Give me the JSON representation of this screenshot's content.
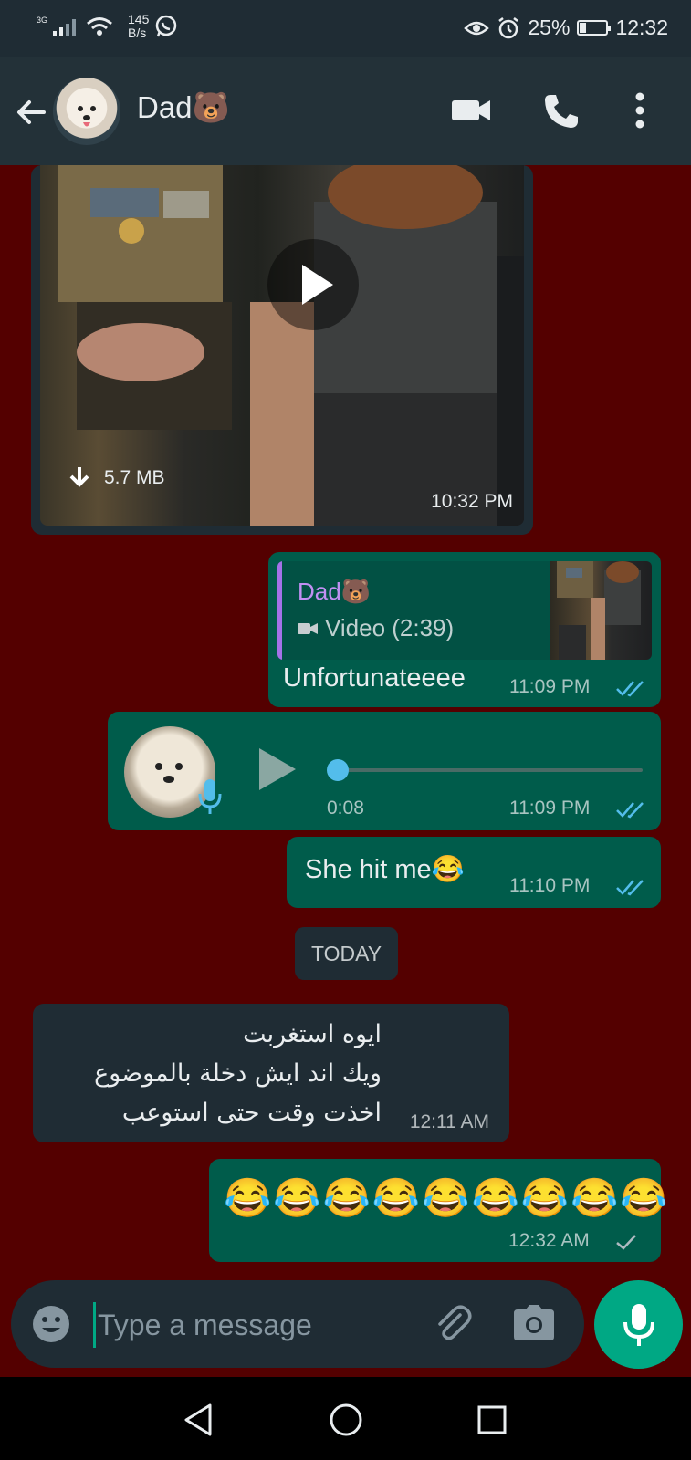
{
  "status_bar": {
    "network": "3G",
    "speed_value": "145",
    "speed_unit": "B/s",
    "battery": "25%",
    "battery_level": 0.25,
    "time": "12:32"
  },
  "header": {
    "contact_name": "Dad🐻",
    "icons": [
      "back-arrow-icon",
      "avatar",
      "video-call-icon",
      "phone-icon",
      "more-vert-icon"
    ]
  },
  "messages": {
    "video": {
      "size": "5.7 MB",
      "time": "10:32 PM"
    },
    "reply": {
      "quoted_name": "Dad🐻",
      "quoted_text": "Video (2:39)",
      "text": "Unfortunateeee",
      "time": "11:09 PM"
    },
    "voice": {
      "duration": "0:08",
      "time": "11:09 PM",
      "progress": 0
    },
    "she_hit": {
      "text": "She hit me😂",
      "time": "11:10 PM"
    },
    "day_separator": "TODAY",
    "arabic": {
      "line1": "ايوه استغربت",
      "line2": "ويك اند ايش دخلة بالموضوع",
      "line3": "اخذت وقت حتى استوعب",
      "time": "12:11 AM"
    },
    "laughs": {
      "emojis": [
        "😂",
        "😂",
        "😂",
        "😂",
        "😂",
        "😂",
        "😂",
        "😂",
        "😂"
      ],
      "time": "12:32 AM"
    }
  },
  "composer": {
    "placeholder": "Type a message"
  },
  "colors": {
    "background": "#540000",
    "incoming": "#1f2c34",
    "outgoing": "#005c4b",
    "accent": "#00a884",
    "read_ticks": "#53bdeb"
  }
}
